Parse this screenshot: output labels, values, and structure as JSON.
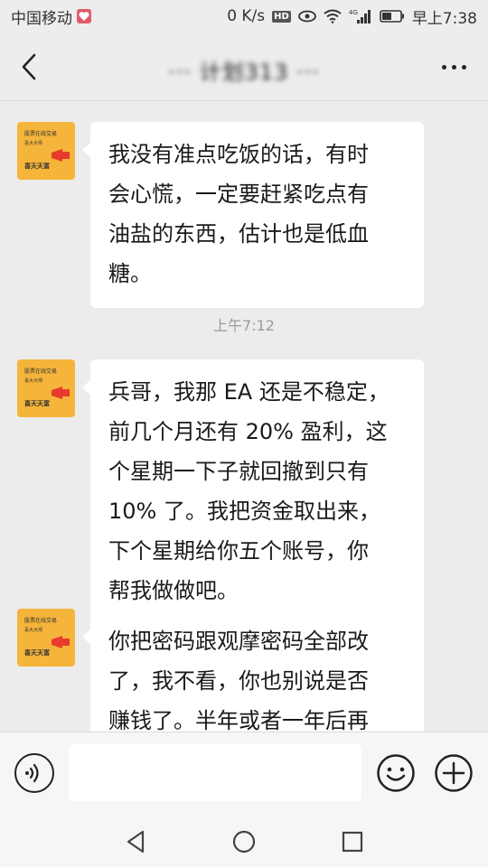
{
  "status_bar": {
    "carrier": "中国移动",
    "net_speed": "0 K/s",
    "hd": "HD",
    "signal_label": "4G",
    "time": "早上7:38"
  },
  "header": {
    "title": "··· 计划313 ···",
    "back_icon": "chevron-left-icon",
    "more_icon": "more-dots-icon"
  },
  "avatar": {
    "line1": "股票在线交易",
    "line2": "喜大大师",
    "line3": "喜天天富"
  },
  "messages": [
    {
      "lines": [
        "我没有准点吃饭的话，有时",
        "会心慌，一定要赶紧吃点有",
        "油盐的东西，估计也是低血",
        "糖。"
      ]
    },
    {
      "lines": [
        "兵哥，我那 EA 还是不稳定，",
        "前几个月还有 20% 盈利，这",
        "个星期一下子就回撤到只有",
        "10% 了。我把资金取出来，",
        "下个星期给你五个账号，你",
        "帮我做做吧。"
      ]
    },
    {
      "lines": [
        "你把密码跟观摩密码全部改",
        "了，我不看，你也别说是否",
        "赚钱了。半年或者一年后再"
      ]
    }
  ],
  "timestamp": "上午7:12",
  "input": {
    "placeholder": "",
    "voice_icon": "voice-icon",
    "emoji_icon": "emoji-icon",
    "plus_icon": "plus-icon"
  },
  "nav": {
    "back_icon": "triangle-back-icon",
    "home_icon": "circle-home-icon",
    "recent_icon": "square-recent-icon"
  }
}
